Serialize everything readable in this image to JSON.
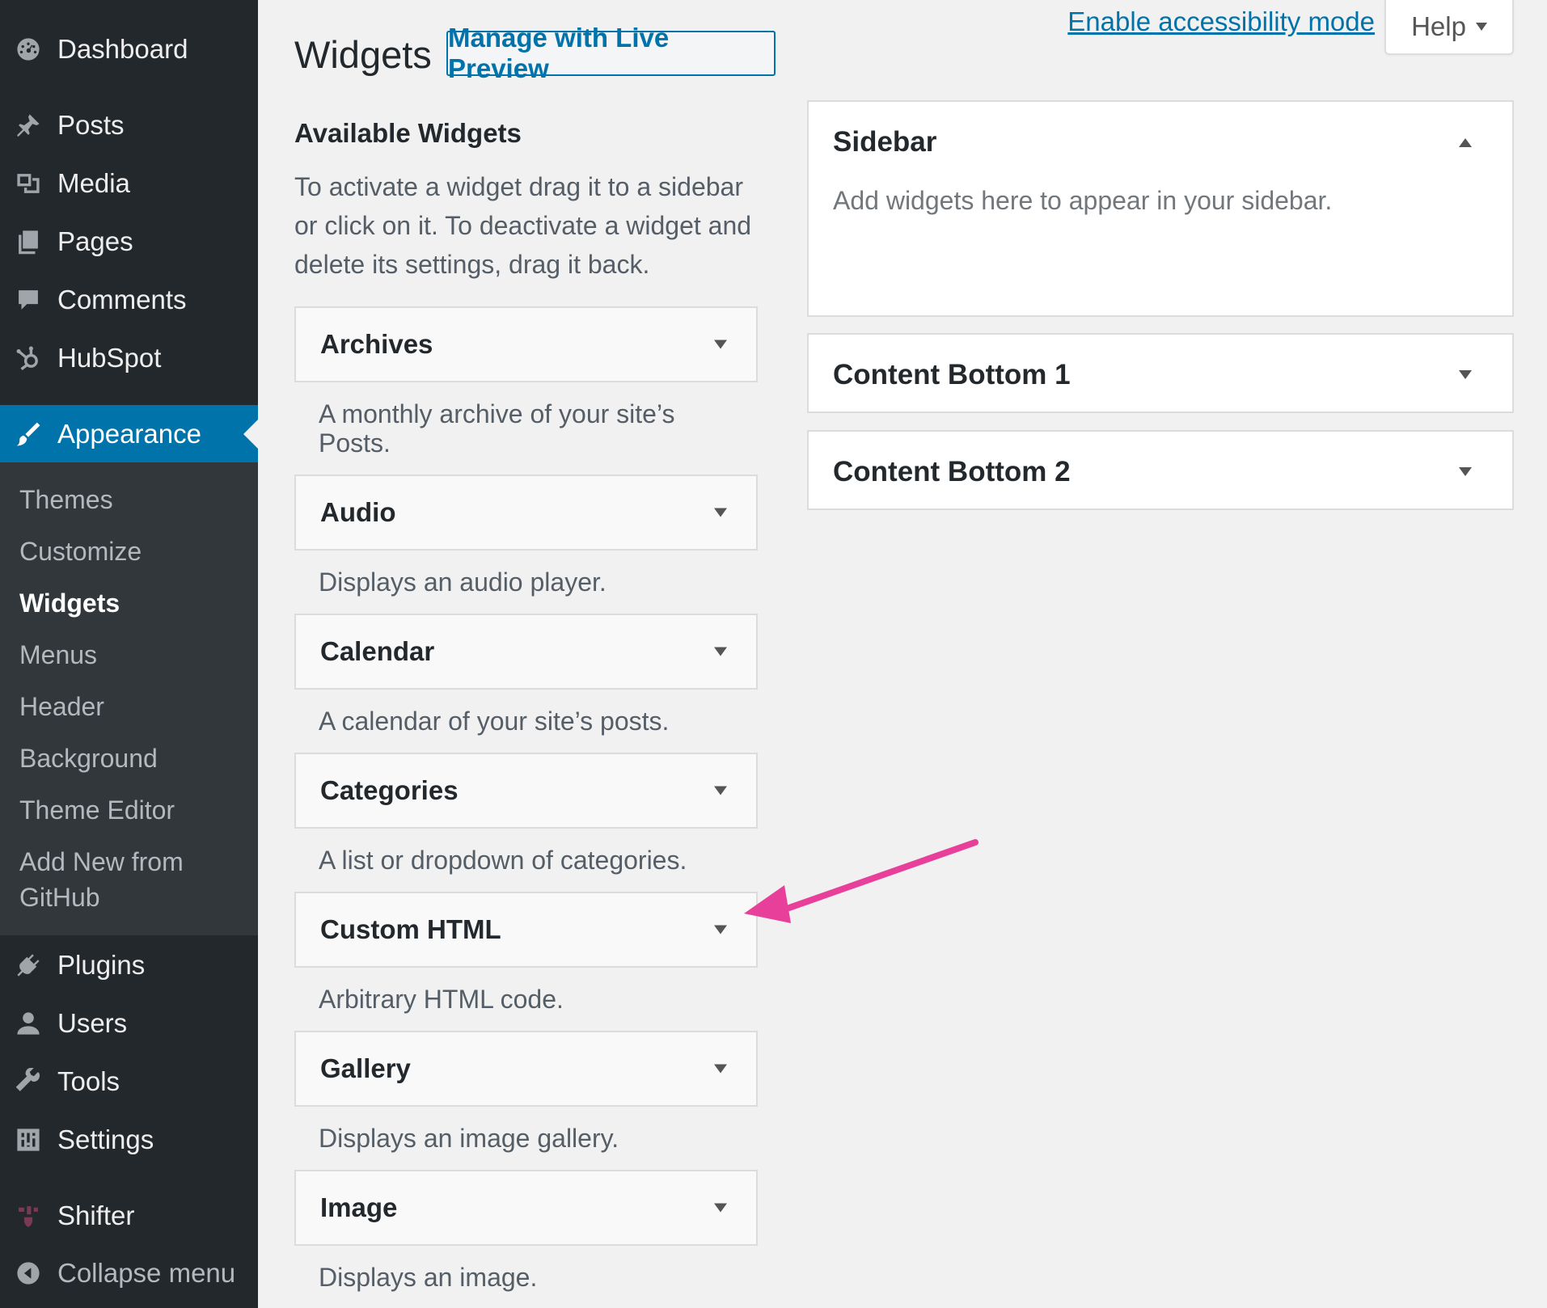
{
  "admin_menu": {
    "items": [
      {
        "label": "Dashboard",
        "icon": "dashboard-icon"
      },
      {
        "label": "Posts",
        "icon": "pin-icon"
      },
      {
        "label": "Media",
        "icon": "media-icon"
      },
      {
        "label": "Pages",
        "icon": "pages-icon"
      },
      {
        "label": "Comments",
        "icon": "comment-icon"
      },
      {
        "label": "HubSpot",
        "icon": "hubspot-icon"
      },
      {
        "label": "Appearance",
        "icon": "paintbrush-icon"
      },
      {
        "label": "Plugins",
        "icon": "plugin-icon"
      },
      {
        "label": "Users",
        "icon": "user-icon"
      },
      {
        "label": "Tools",
        "icon": "wrench-icon"
      },
      {
        "label": "Settings",
        "icon": "settings-icon"
      },
      {
        "label": "Shifter",
        "icon": "shifter-icon"
      },
      {
        "label": "Collapse menu",
        "icon": "collapse-icon"
      }
    ],
    "appearance_submenu": [
      "Themes",
      "Customize",
      "Widgets",
      "Menus",
      "Header",
      "Background",
      "Theme Editor",
      "Add New from",
      "GitHub"
    ],
    "current_item": "Appearance",
    "current_submenu": "Widgets"
  },
  "screen_meta": {
    "accessibility_link": "Enable accessibility mode",
    "help_label": "Help"
  },
  "header": {
    "title": "Widgets",
    "live_preview_button": "Manage with Live Preview"
  },
  "available": {
    "title": "Available Widgets",
    "description": "To activate a widget drag it to a sidebar or click on it. To deactivate a widget and delete its settings, drag it back.",
    "widgets": [
      {
        "title": "Archives",
        "description": "A monthly archive of your site’s Posts."
      },
      {
        "title": "Audio",
        "description": "Displays an audio player."
      },
      {
        "title": "Calendar",
        "description": "A calendar of your site’s posts."
      },
      {
        "title": "Categories",
        "description": "A list or dropdown of categories."
      },
      {
        "title": "Custom HTML",
        "description": "Arbitrary HTML code."
      },
      {
        "title": "Gallery",
        "description": "Displays an image gallery."
      },
      {
        "title": "Image",
        "description": "Displays an image."
      }
    ]
  },
  "widget_areas": [
    {
      "title": "Sidebar",
      "description": "Add widgets here to appear in your sidebar.",
      "expanded": true
    },
    {
      "title": "Content Bottom 1",
      "expanded": false
    },
    {
      "title": "Content Bottom 2",
      "expanded": false
    }
  ],
  "colors": {
    "menu_bg": "#23282d",
    "submenu_bg": "#32373c",
    "accent": "#0073aa",
    "annotation_arrow": "#e8409a"
  }
}
